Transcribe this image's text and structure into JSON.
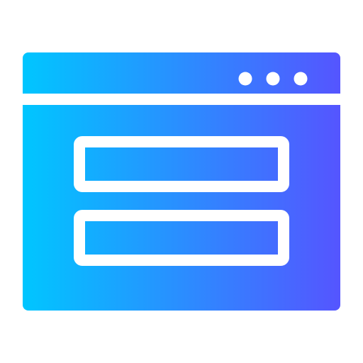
{
  "icon": {
    "name": "browser-window-form-icon",
    "colors": {
      "gradient_start": "#00C6FF",
      "gradient_end": "#5555FF",
      "foreground": "#FFFFFF"
    },
    "window_control_dots": 3,
    "form_fields": 2
  }
}
